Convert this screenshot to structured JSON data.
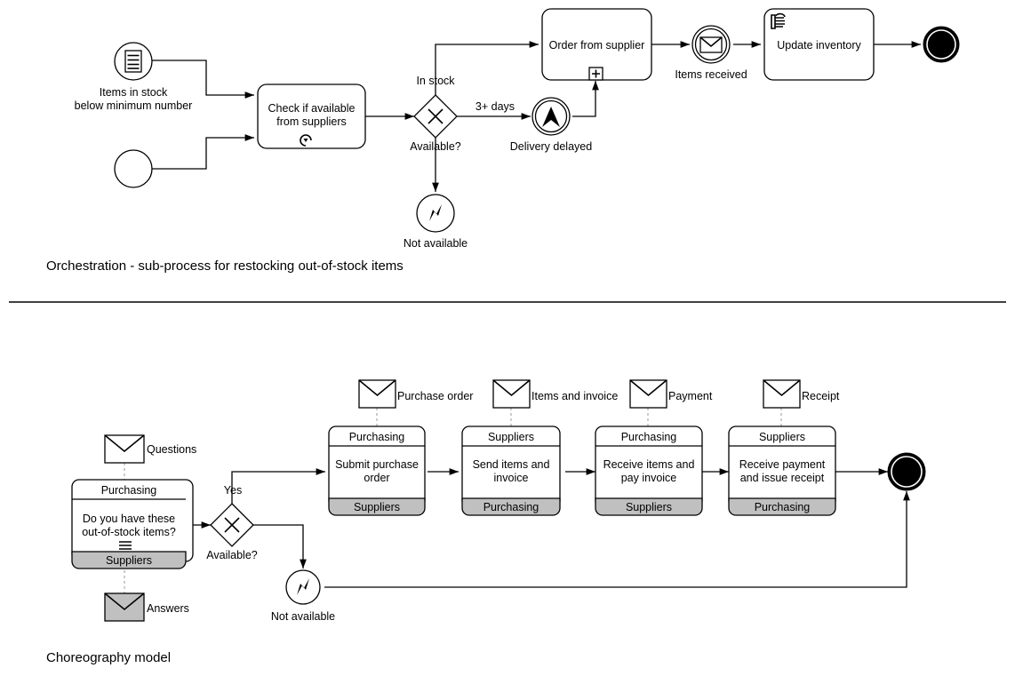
{
  "captions": {
    "orchestration": "Orchestration - sub-process for restocking out-of-stock items",
    "choreography": "Choreography model"
  },
  "orchestration": {
    "start_conditional_label_line1": "Items in stock",
    "start_conditional_label_line2": "below minimum number",
    "task_check_line1": "Check if available",
    "task_check_line2": "from suppliers",
    "gateway_label": "Available?",
    "flow_in_stock": "In stock",
    "flow_3_days": "3+ days",
    "event_delivery_delayed": "Delivery delayed",
    "task_order": "Order from supplier",
    "event_items_received": "Items received",
    "task_update_inventory": "Update inventory",
    "end_not_available": "Not available"
  },
  "choreography": {
    "message_questions": "Questions",
    "message_answers": "Answers",
    "gateway_label": "Available?",
    "flow_yes": "Yes",
    "end_not_available": "Not available",
    "tasks": [
      {
        "top_participant": "Purchasing",
        "name_line1": "Do you have these",
        "name_line2": "out-of-stock items?",
        "bottom_participant": "Suppliers",
        "marker": "parallel-multi-instance"
      },
      {
        "top_participant": "Purchasing",
        "name_line1": "Submit purchase",
        "name_line2": "order",
        "bottom_participant": "Suppliers",
        "message": "Purchase order"
      },
      {
        "top_participant": "Suppliers",
        "name_line1": "Send items and",
        "name_line2": "invoice",
        "bottom_participant": "Purchasing",
        "message": "Items and invoice"
      },
      {
        "top_participant": "Purchasing",
        "name_line1": "Receive items and",
        "name_line2": "pay invoice",
        "bottom_participant": "Suppliers",
        "message": "Payment"
      },
      {
        "top_participant": "Suppliers",
        "name_line1": "Receive payment",
        "name_line2": "and issue receipt",
        "bottom_participant": "Purchasing",
        "message": "Receipt"
      }
    ]
  },
  "colors": {
    "stroke": "#000000",
    "fill": "#ffffff",
    "band_fill": "#c0c0c0",
    "message_flow": "#999999"
  }
}
